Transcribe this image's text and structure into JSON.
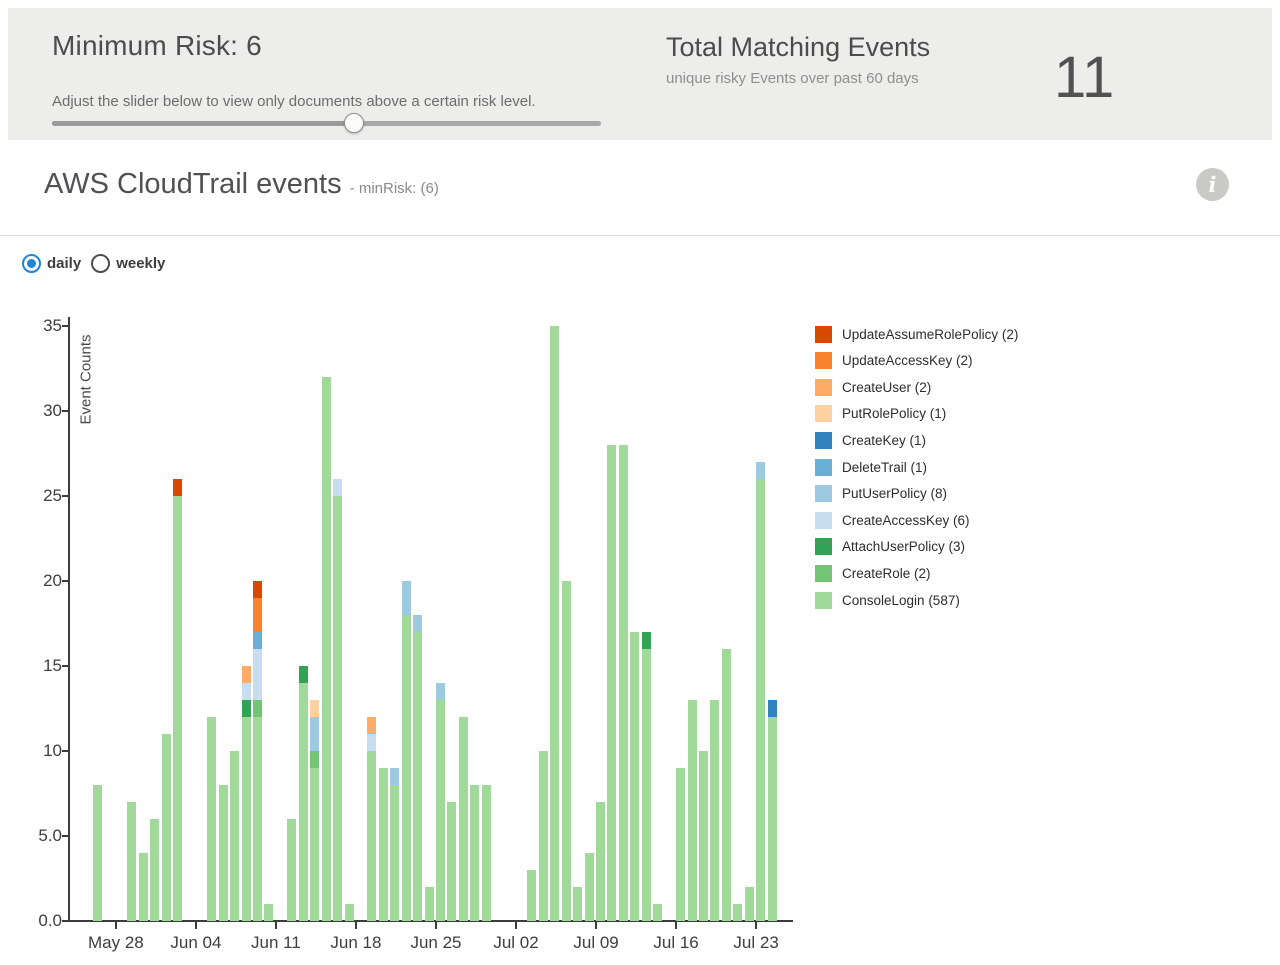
{
  "risk_panel": {
    "title": "Minimum Risk: 6",
    "caption": "Adjust the slider below to view only documents above a certain risk level.",
    "slider_pct": 55
  },
  "metric_panel": {
    "title": "Total Matching Events",
    "subtitle": "unique risky Events over past 60 days",
    "value": "11"
  },
  "header": {
    "title": "AWS CloudTrail events",
    "subtitle": "- minRisk: (6)",
    "info_glyph": "i"
  },
  "controls": {
    "options": [
      {
        "label": "daily",
        "selected": true
      },
      {
        "label": "weekly",
        "selected": false
      }
    ]
  },
  "chart_data": {
    "type": "bar",
    "stacked": true,
    "title": "AWS CloudTrail events - minRisk: (6)",
    "xlabel": "",
    "ylabel": "Event Counts",
    "ylim": [
      0,
      35
    ],
    "grid": false,
    "legend_position": "right",
    "yticks": [
      {
        "value": 0,
        "label": "0.0"
      },
      {
        "value": 5,
        "label": "5.0"
      },
      {
        "value": 10,
        "label": "10"
      },
      {
        "value": 15,
        "label": "15"
      },
      {
        "value": 20,
        "label": "20"
      },
      {
        "value": 25,
        "label": "25"
      },
      {
        "value": 30,
        "label": "30"
      },
      {
        "value": 35,
        "label": "35"
      }
    ],
    "xticks": [
      {
        "date": "May 28",
        "label": "May 28"
      },
      {
        "date": "Jun 04",
        "label": "Jun 04"
      },
      {
        "date": "Jun 11",
        "label": "Jun 11"
      },
      {
        "date": "Jun 18",
        "label": "Jun 18"
      },
      {
        "date": "Jun 25",
        "label": "Jun 25"
      },
      {
        "date": "Jul 02",
        "label": "Jul 02"
      },
      {
        "date": "Jul 09",
        "label": "Jul 09"
      },
      {
        "date": "Jul 16",
        "label": "Jul 16"
      },
      {
        "date": "Jul 23",
        "label": "Jul 23"
      }
    ],
    "legend": [
      {
        "label": "UpdateAssumeRolePolicy",
        "count": 2,
        "color": "#d94801"
      },
      {
        "label": "UpdateAccessKey",
        "count": 2,
        "color": "#f8832c"
      },
      {
        "label": "CreateUser",
        "count": 2,
        "color": "#fdab67"
      },
      {
        "label": "PutRolePolicy",
        "count": 1,
        "color": "#fdd2a0"
      },
      {
        "label": "CreateKey",
        "count": 1,
        "color": "#3182bd"
      },
      {
        "label": "DeleteTrail",
        "count": 1,
        "color": "#6baed6"
      },
      {
        "label": "PutUserPolicy",
        "count": 8,
        "color": "#9ecae1"
      },
      {
        "label": "CreateAccessKey",
        "count": 6,
        "color": "#c9ddf0"
      },
      {
        "label": "AttachUserPolicy",
        "count": 3,
        "color": "#31a354"
      },
      {
        "label": "CreateRole",
        "count": 2,
        "color": "#74c476"
      },
      {
        "label": "ConsoleLogin",
        "count": 587,
        "color": "#a1d99b"
      }
    ],
    "bars": [
      {
        "date": "May 26",
        "segments": {
          "ConsoleLogin": 8
        }
      },
      {
        "date": "May 29",
        "segments": {
          "ConsoleLogin": 7
        }
      },
      {
        "date": "May 30",
        "segments": {
          "ConsoleLogin": 4
        }
      },
      {
        "date": "May 31",
        "segments": {
          "ConsoleLogin": 6
        }
      },
      {
        "date": "Jun 01",
        "segments": {
          "ConsoleLogin": 11
        }
      },
      {
        "date": "Jun 02",
        "segments": {
          "ConsoleLogin": 25,
          "UpdateAssumeRolePolicy": 1
        }
      },
      {
        "date": "Jun 05",
        "segments": {
          "ConsoleLogin": 12
        }
      },
      {
        "date": "Jun 06",
        "segments": {
          "ConsoleLogin": 8
        }
      },
      {
        "date": "Jun 07",
        "segments": {
          "ConsoleLogin": 10
        }
      },
      {
        "date": "Jun 08",
        "segments": {
          "ConsoleLogin": 12,
          "AttachUserPolicy": 1,
          "CreateAccessKey": 1,
          "CreateUser": 1
        }
      },
      {
        "date": "Jun 09",
        "segments": {
          "ConsoleLogin": 12,
          "CreateRole": 1,
          "CreateAccessKey": 3,
          "DeleteTrail": 1,
          "UpdateAccessKey": 2,
          "UpdateAssumeRolePolicy": 1
        }
      },
      {
        "date": "Jun 10",
        "segments": {
          "ConsoleLogin": 1
        }
      },
      {
        "date": "Jun 12",
        "segments": {
          "ConsoleLogin": 6
        }
      },
      {
        "date": "Jun 13",
        "segments": {
          "ConsoleLogin": 14,
          "AttachUserPolicy": 1
        }
      },
      {
        "date": "Jun 14",
        "segments": {
          "ConsoleLogin": 9,
          "CreateRole": 1,
          "PutUserPolicy": 2,
          "PutRolePolicy": 1
        }
      },
      {
        "date": "Jun 15",
        "segments": {
          "ConsoleLogin": 32
        }
      },
      {
        "date": "Jun 16",
        "segments": {
          "ConsoleLogin": 25,
          "CreateAccessKey": 1
        }
      },
      {
        "date": "Jun 17",
        "segments": {
          "ConsoleLogin": 1
        }
      },
      {
        "date": "Jun 19",
        "segments": {
          "ConsoleLogin": 10,
          "CreateAccessKey": 1,
          "CreateUser": 1
        }
      },
      {
        "date": "Jun 20",
        "segments": {
          "ConsoleLogin": 9
        }
      },
      {
        "date": "Jun 21",
        "segments": {
          "ConsoleLogin": 8,
          "PutUserPolicy": 1
        }
      },
      {
        "date": "Jun 22",
        "segments": {
          "ConsoleLogin": 18,
          "PutUserPolicy": 2
        }
      },
      {
        "date": "Jun 23",
        "segments": {
          "ConsoleLogin": 17,
          "PutUserPolicy": 1
        }
      },
      {
        "date": "Jun 24",
        "segments": {
          "ConsoleLogin": 2
        }
      },
      {
        "date": "Jun 25",
        "segments": {
          "ConsoleLogin": 13,
          "PutUserPolicy": 1
        }
      },
      {
        "date": "Jun 26",
        "segments": {
          "ConsoleLogin": 7
        }
      },
      {
        "date": "Jun 27",
        "segments": {
          "ConsoleLogin": 12
        }
      },
      {
        "date": "Jun 28",
        "segments": {
          "ConsoleLogin": 8
        }
      },
      {
        "date": "Jun 29",
        "segments": {
          "ConsoleLogin": 8
        }
      },
      {
        "date": "Jul 03",
        "segments": {
          "ConsoleLogin": 3
        }
      },
      {
        "date": "Jul 04",
        "segments": {
          "ConsoleLogin": 10
        }
      },
      {
        "date": "Jul 05",
        "segments": {
          "ConsoleLogin": 35
        }
      },
      {
        "date": "Jul 06",
        "segments": {
          "ConsoleLogin": 20
        }
      },
      {
        "date": "Jul 07",
        "segments": {
          "ConsoleLogin": 2
        }
      },
      {
        "date": "Jul 08",
        "segments": {
          "ConsoleLogin": 4
        }
      },
      {
        "date": "Jul 09",
        "segments": {
          "ConsoleLogin": 7
        }
      },
      {
        "date": "Jul 10",
        "segments": {
          "ConsoleLogin": 28
        }
      },
      {
        "date": "Jul 11",
        "segments": {
          "ConsoleLogin": 28
        }
      },
      {
        "date": "Jul 12",
        "segments": {
          "ConsoleLogin": 17
        }
      },
      {
        "date": "Jul 13",
        "segments": {
          "ConsoleLogin": 16,
          "AttachUserPolicy": 1
        }
      },
      {
        "date": "Jul 14",
        "segments": {
          "ConsoleLogin": 1
        }
      },
      {
        "date": "Jul 16",
        "segments": {
          "ConsoleLogin": 9
        }
      },
      {
        "date": "Jul 17",
        "segments": {
          "ConsoleLogin": 13
        }
      },
      {
        "date": "Jul 18",
        "segments": {
          "ConsoleLogin": 10
        }
      },
      {
        "date": "Jul 19",
        "segments": {
          "ConsoleLogin": 13
        }
      },
      {
        "date": "Jul 20",
        "segments": {
          "ConsoleLogin": 16
        }
      },
      {
        "date": "Jul 21",
        "segments": {
          "ConsoleLogin": 1
        }
      },
      {
        "date": "Jul 22",
        "segments": {
          "ConsoleLogin": 2
        }
      },
      {
        "date": "Jul 23",
        "segments": {
          "ConsoleLogin": 26,
          "PutUserPolicy": 1
        }
      },
      {
        "date": "Jul 24",
        "segments": {
          "ConsoleLogin": 12,
          "CreateKey": 1
        }
      }
    ]
  }
}
